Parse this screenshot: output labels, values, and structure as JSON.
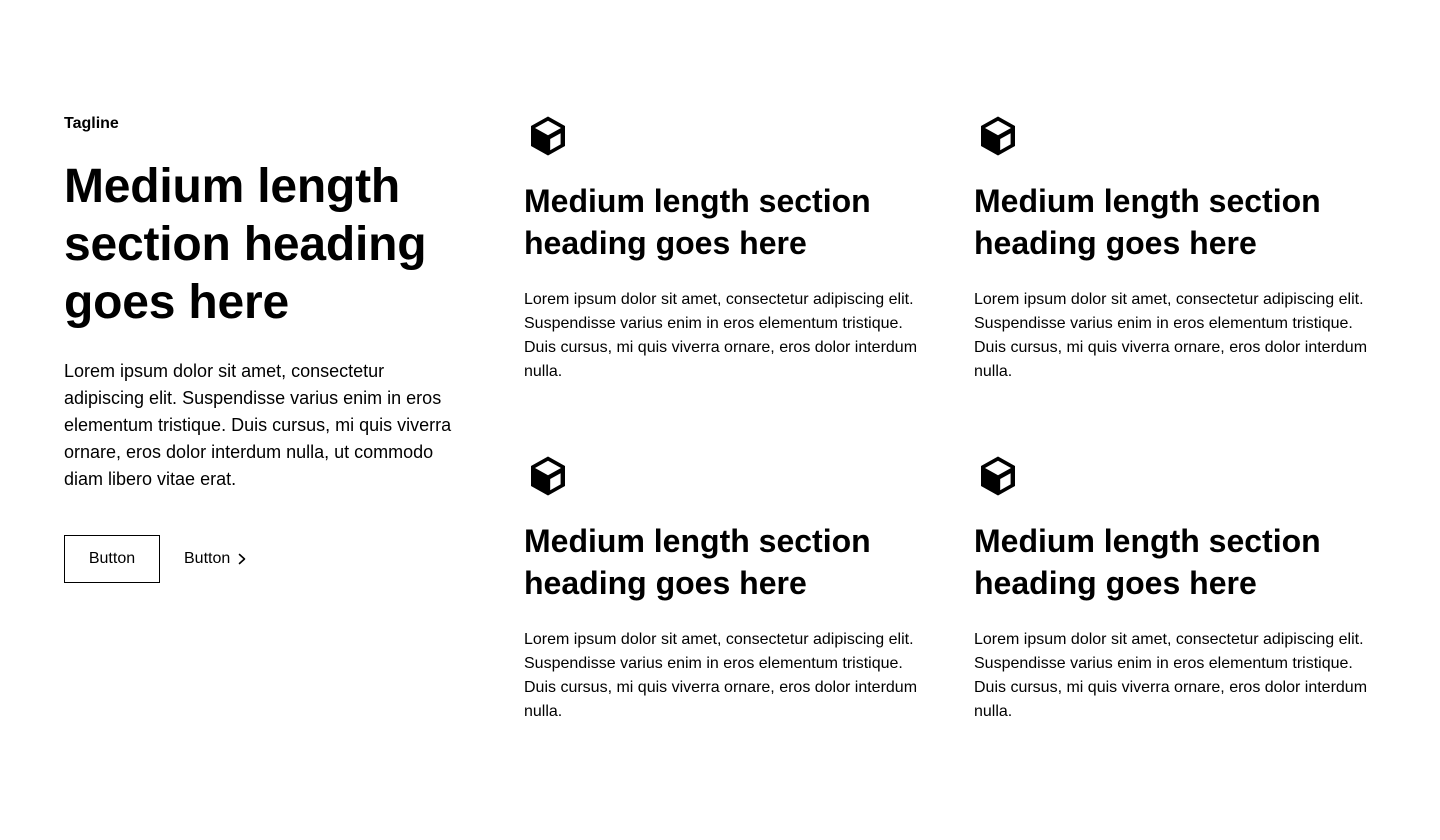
{
  "intro": {
    "tagline": "Tagline",
    "heading": "Medium length section heading goes here",
    "description": "Lorem ipsum dolor sit amet, consectetur adipiscing elit. Suspendisse varius enim in eros elementum tristique. Duis cursus, mi quis viverra ornare, eros dolor interdum nulla, ut commodo diam libero vitae erat.",
    "primary_button": "Button",
    "link_button": "Button",
    "link_icon": "chevron-right-icon"
  },
  "features": [
    {
      "icon": "cube-icon",
      "heading": "Medium length section heading goes here",
      "description": "Lorem ipsum dolor sit amet, consectetur adipiscing elit. Suspendisse varius enim in eros elementum tristique. Duis cursus, mi quis viverra ornare, eros dolor interdum nulla."
    },
    {
      "icon": "cube-icon",
      "heading": "Medium length section heading goes here",
      "description": "Lorem ipsum dolor sit amet, consectetur adipiscing elit. Suspendisse varius enim in eros elementum tristique. Duis cursus, mi quis viverra ornare, eros dolor interdum nulla."
    },
    {
      "icon": "cube-icon",
      "heading": "Medium length section heading goes here",
      "description": "Lorem ipsum dolor sit amet, consectetur adipiscing elit. Suspendisse varius enim in eros elementum tristique. Duis cursus, mi quis viverra ornare, eros dolor interdum nulla."
    },
    {
      "icon": "cube-icon",
      "heading": "Medium length section heading goes here",
      "description": "Lorem ipsum dolor sit amet, consectetur adipiscing elit. Suspendisse varius enim in eros elementum tristique. Duis cursus, mi quis viverra ornare, eros dolor interdum nulla."
    }
  ],
  "colors": {
    "text": "#000000",
    "background": "#ffffff",
    "border": "#000000"
  }
}
